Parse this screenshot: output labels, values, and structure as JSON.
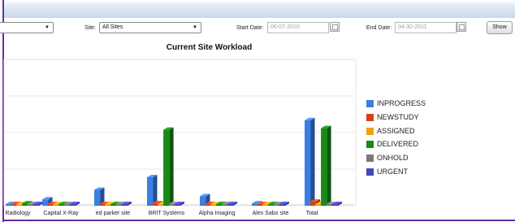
{
  "filters": {
    "first_select_value": "",
    "site_label": "Site:",
    "site_value": "All Sites",
    "start_label": "Start Date:",
    "start_value": "06-07-2010",
    "end_label": "End Date:",
    "end_value": "04-30-2011",
    "show_label": "Show"
  },
  "chart_data": {
    "type": "bar",
    "title": "Current Site Workload",
    "categories": [
      "Radiology",
      "Capital X-Ray",
      "ed parker site",
      "BRIT Systems",
      "Alpha Imaging",
      "Alex Sabo site",
      "Total"
    ],
    "ylim": [
      0,
      185
    ],
    "grid": true,
    "legend_position": "right",
    "series": [
      {
        "name": "INPROGRESS",
        "color": "#3d7ee3",
        "values": [
          0,
          8,
          20,
          36,
          12,
          3,
          108
        ]
      },
      {
        "name": "NEWSTUDY",
        "color": "#d8401c",
        "values": [
          0,
          0,
          0,
          3,
          2,
          0,
          5
        ]
      },
      {
        "name": "ASSIGNED",
        "color": "#f2a012",
        "values": [
          0,
          0,
          0,
          1,
          1,
          0,
          2
        ]
      },
      {
        "name": "DELIVERED",
        "color": "#178a17",
        "values": [
          3,
          0,
          0,
          96,
          2,
          0,
          98
        ]
      },
      {
        "name": "ONHOLD",
        "color": "#7a7a7a",
        "values": [
          0,
          0,
          0,
          0,
          0,
          0,
          0
        ]
      },
      {
        "name": "URGENT",
        "color": "#4a44c2",
        "values": [
          0,
          0,
          0,
          0,
          0,
          0,
          0
        ]
      }
    ]
  }
}
